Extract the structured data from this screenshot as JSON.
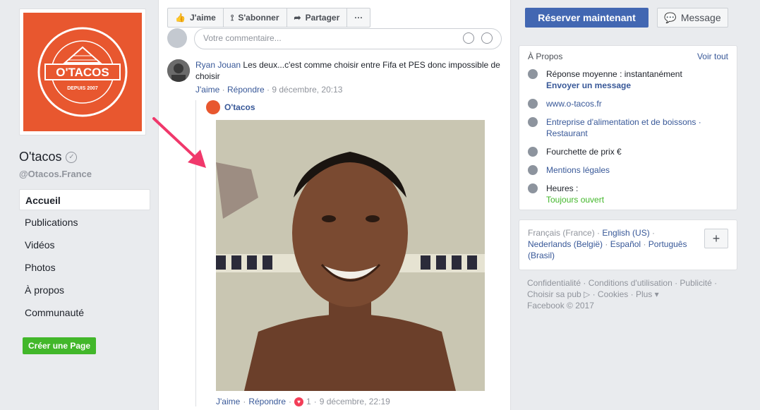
{
  "page": {
    "name": "O'tacos",
    "handle": "@Otacos.France",
    "logo_text": "O'TACOS"
  },
  "nav": {
    "items": [
      {
        "label": "Accueil",
        "active": true
      },
      {
        "label": "Publications"
      },
      {
        "label": "Vidéos"
      },
      {
        "label": "Photos"
      },
      {
        "label": "À propos"
      },
      {
        "label": "Communauté"
      }
    ],
    "create_page": "Créer une Page"
  },
  "actions": {
    "like": "J'aime",
    "subscribe": "S'abonner",
    "share": "Partager",
    "more": "···"
  },
  "comment_input": {
    "placeholder": "Votre commentaire..."
  },
  "comment": {
    "author": "Ryan Jouan",
    "text": "Les deux...c'est comme choisir entre Fifa et PES donc impossible de choisir",
    "like": "J'aime",
    "reply": "Répondre",
    "time": "9 décembre, 20:13"
  },
  "reply": {
    "author": "O'tacos",
    "like": "J'aime",
    "reply": "Répondre",
    "reactions": "1",
    "time": "9 décembre, 22:19"
  },
  "header_buttons": {
    "reserve": "Réserver maintenant",
    "message": "Message"
  },
  "about": {
    "title": "À Propos",
    "see_all": "Voir tout",
    "response": "Réponse moyenne : instantanément",
    "send_message": "Envoyer un message",
    "website": "www.o-tacos.fr",
    "category": "Entreprise d'alimentation et de boissons · Restaurant",
    "price": "Fourchette de prix €",
    "legal": "Mentions légales",
    "hours_label": "Heures :",
    "hours_value": "Toujours ouvert"
  },
  "languages": {
    "current": "Français (France) · ",
    "l1": "English (US)",
    "l2": "Nederlands (België)",
    "l3": "Español",
    "l4": "Português (Brasil)"
  },
  "footer": {
    "text": "Confidentialité · Conditions d'utilisation · Publicité · Choisir sa pub ▷ · Cookies · Plus ▾",
    "copyright": "Facebook © 2017"
  },
  "colors": {
    "accent": "#4267b2",
    "brand": "#e8572f",
    "link": "#385898",
    "green": "#42b72a",
    "arrow": "#f0386b"
  }
}
